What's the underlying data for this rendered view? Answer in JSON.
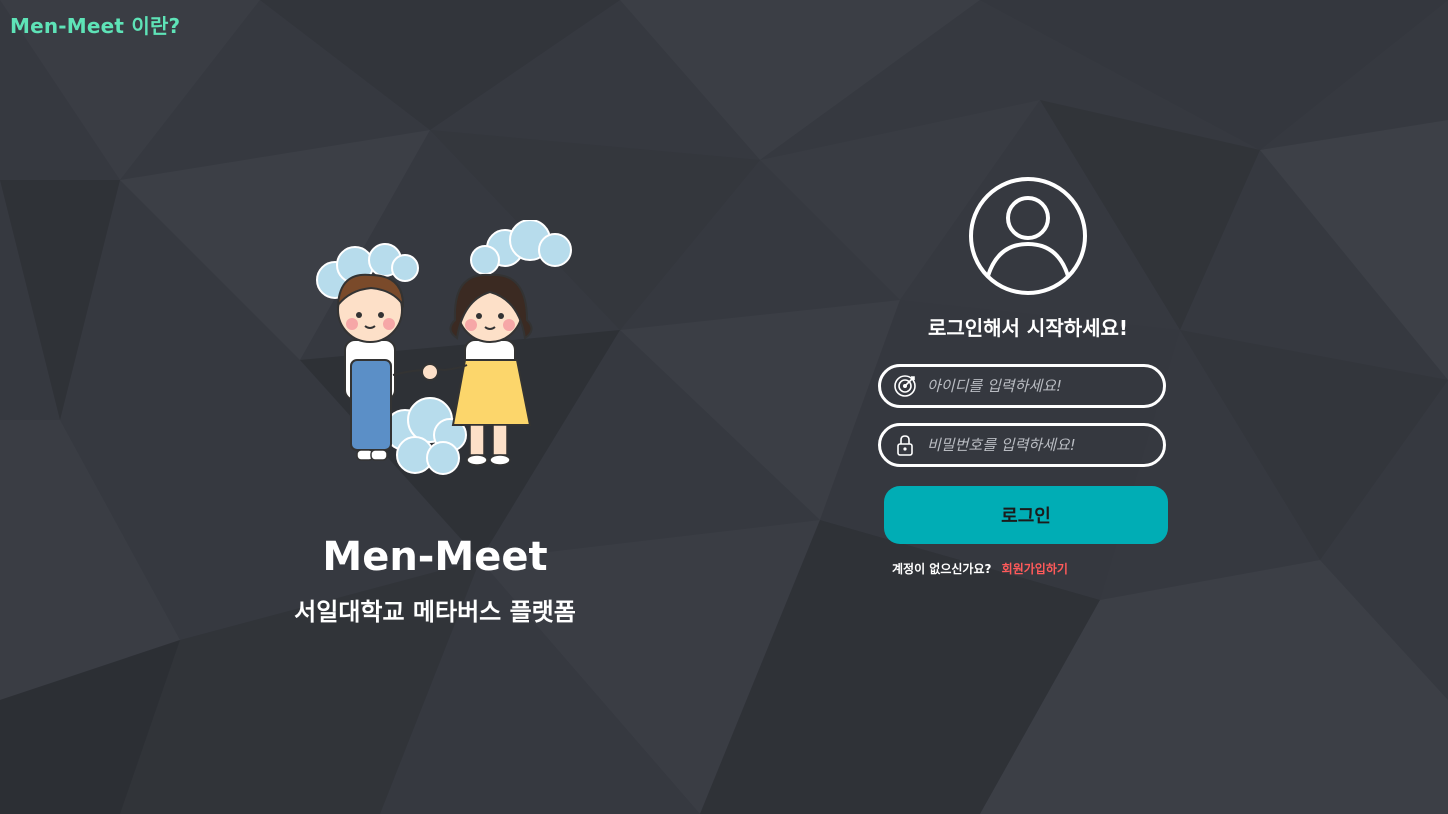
{
  "header": {
    "about_link": "Men-Meet 이란?"
  },
  "brand": {
    "title": "Men-Meet",
    "subtitle": "서일대학교 메타버스 플랫폼"
  },
  "login": {
    "heading": "로그인해서 시작하세요!",
    "id_placeholder": "아이디를 입력하세요!",
    "password_placeholder": "비밀번호를 입력하세요!",
    "button_label": "로그인",
    "signup_question": "계정이 없으신가요?",
    "signup_link": "회원가입하기"
  },
  "icons": {
    "avatar": "user-circle-icon",
    "id_field": "target-icon",
    "password_field": "lock-icon"
  },
  "colors": {
    "background": "#363940",
    "accent_link": "#5ee3b7",
    "button": "#00adb5",
    "signup_link": "#ff5a5a"
  }
}
